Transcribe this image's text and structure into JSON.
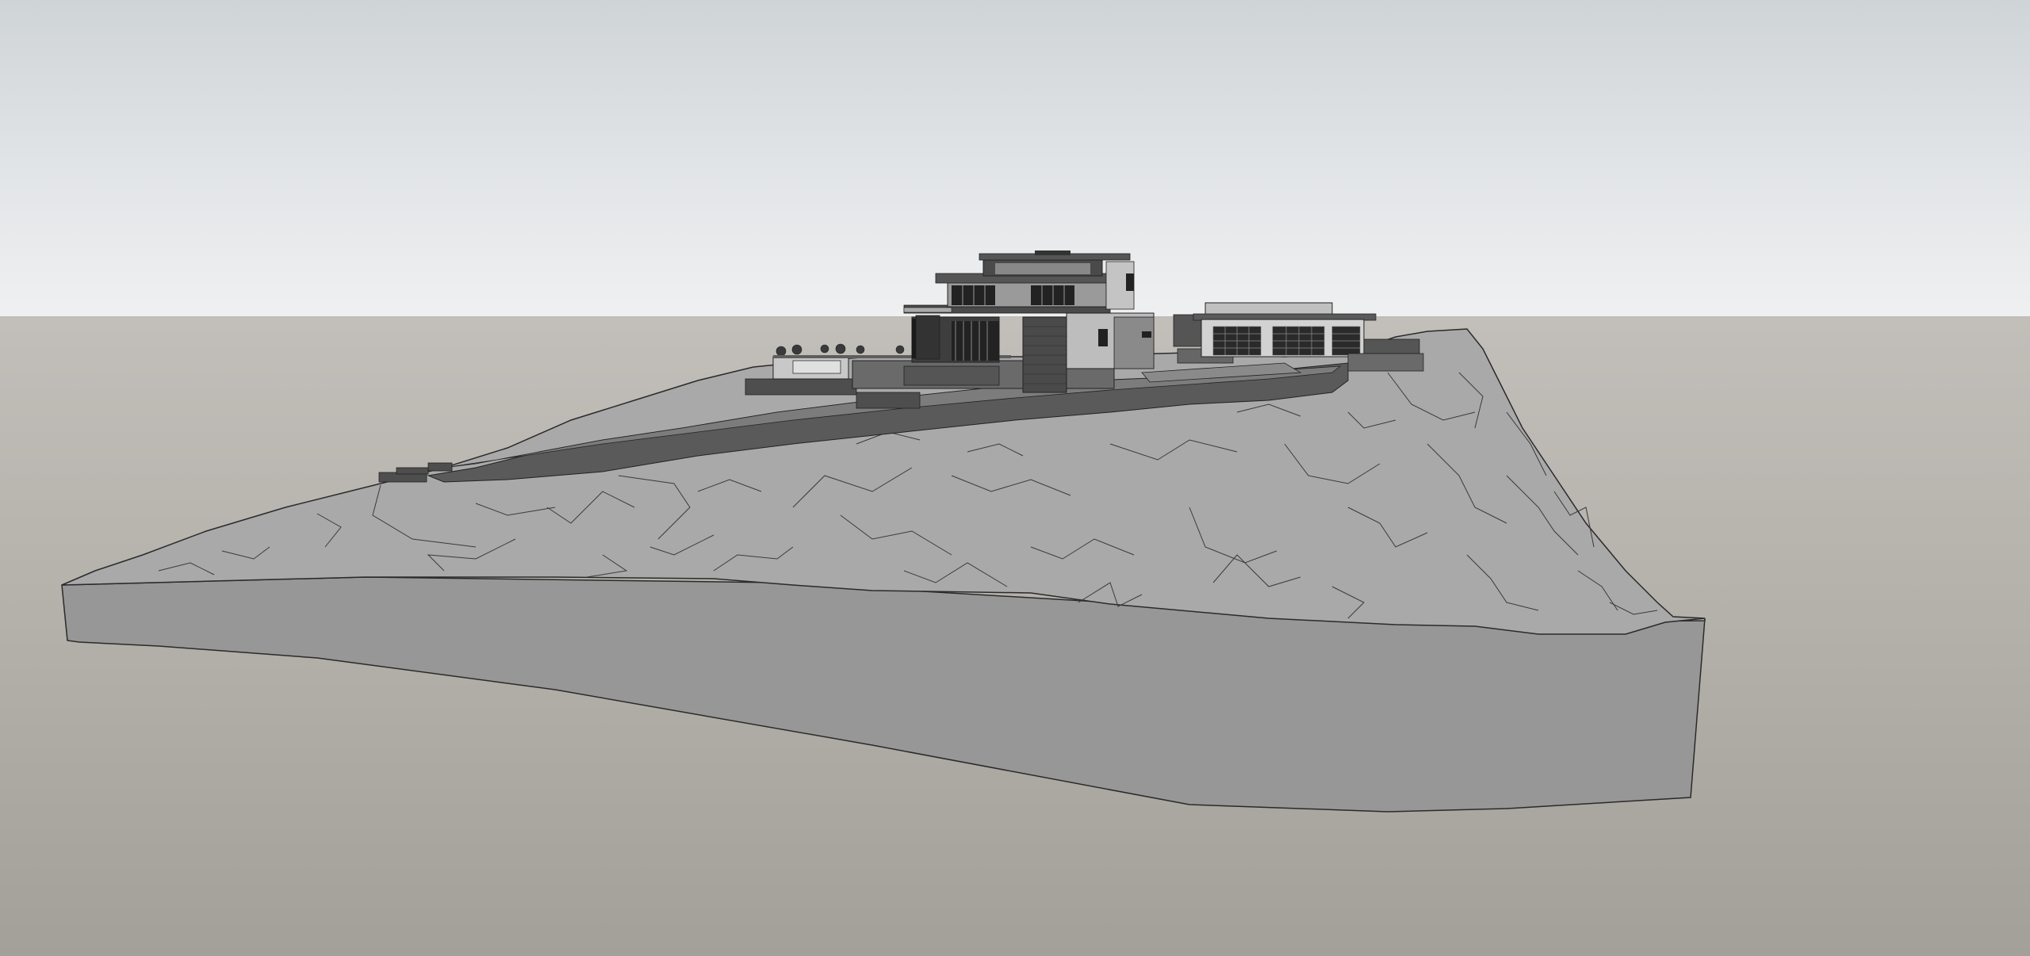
{
  "viewport": {
    "projection": "perspective",
    "style": "shaded-with-edges",
    "sky_color": "#e2e5e7",
    "ground_color": "#b3afa9",
    "terrain_color": "#a8a8a8",
    "terrain_side_color": "#999999",
    "retaining_wall_color": "#5a5a5a"
  },
  "model": {
    "objects": [
      "terrain-mesh",
      "terrain-side-section",
      "retaining-wall",
      "residence",
      "garage",
      "pool-terrace"
    ]
  }
}
